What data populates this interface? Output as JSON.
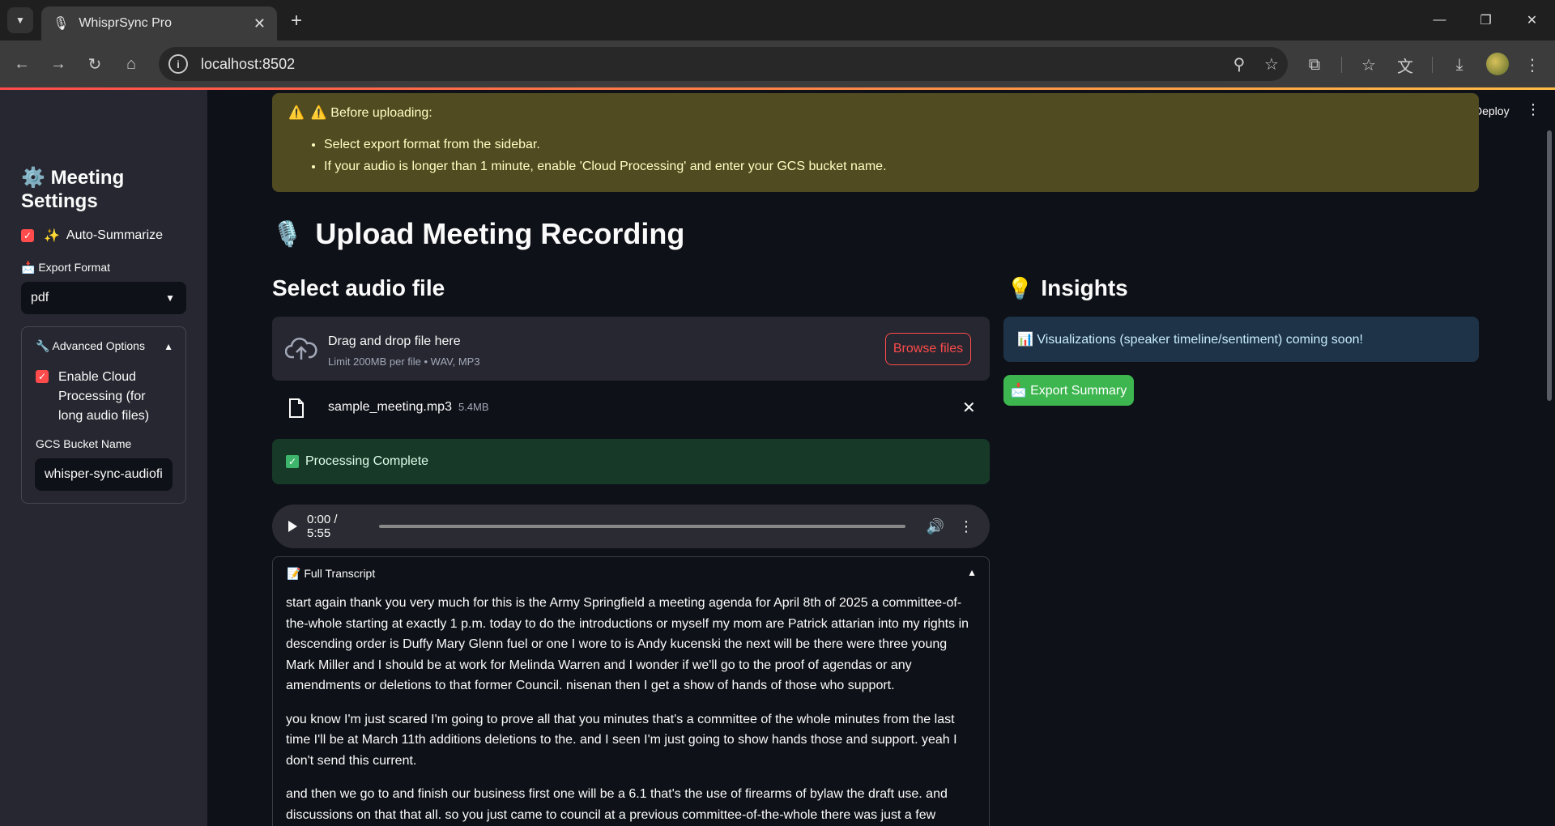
{
  "browser": {
    "tab_title": "WhisprSync Pro",
    "tab_favicon": "🎙",
    "url": "localhost:8502"
  },
  "sidebar": {
    "title_icon": "⚙️",
    "title": "Meeting Settings",
    "auto_summarize": {
      "icon": "✨",
      "label": "Auto-Summarize",
      "checked": true
    },
    "export_format_label": "📩 Export Format",
    "export_format_value": "pdf",
    "advanced": {
      "label": "🔧 Advanced Options",
      "cloud_label": "Enable Cloud Processing (for long audio files)",
      "cloud_checked": true,
      "bucket_label": "GCS Bucket Name",
      "bucket_value": "whisper-sync-audiofiles"
    }
  },
  "header": {
    "deploy": "Deploy"
  },
  "warning": {
    "heading": "⚠️ Before uploading:",
    "items": [
      "Select export format from the sidebar.",
      "If your audio is longer than 1 minute, enable 'Cloud Processing' and enter your GCS bucket name."
    ]
  },
  "main": {
    "title_icon": "🎙️",
    "title": "Upload Meeting Recording",
    "select_heading": "Select audio file",
    "uploader": {
      "drag_text": "Drag and drop file here",
      "limit_text": "Limit 200MB per file • WAV, MP3",
      "browse_label": "Browse files"
    },
    "file": {
      "name": "sample_meeting.mp3",
      "size": "5.4MB"
    },
    "status": "Processing Complete",
    "audio_time": "0:00 / 5:55",
    "transcript": {
      "label": "📝 Full Transcript",
      "paragraphs": [
        "start again thank you very much for this is the Army Springfield a meeting agenda for April 8th of 2025 a committee-of-the-whole starting at exactly 1 p.m. today to do the introductions or myself my mom are Patrick attarian into my rights in descending order is Duffy Mary Glenn fuel or one I wore to is Andy kucenski the next will be there were three young Mark Miller and I should be at work for Melinda Warren and I wonder if we'll go to the proof of agendas or any amendments or deletions to that former Council. nisenan then I get a show of hands of those who support.",
        "you know I'm just scared I'm going to prove all that you minutes that's a committee of the whole minutes from the last time I'll be at March 11th additions deletions to the. and I seen I'm just going to show hands those and support. yeah I don't send this current.",
        "and then we go to and finish our business first one will be a 6.1 that's the use of firearms of bylaw the draft use. and discussions on that that all. so you just came to council at a previous committee-of-the-whole there was just a few suggestions on this so we"
      ]
    }
  },
  "insights": {
    "title_icon": "💡",
    "title": "Insights",
    "info": "📊 Visualizations (speaker timeline/sentiment) coming soon!",
    "export_label": "📩 Export Summary"
  }
}
